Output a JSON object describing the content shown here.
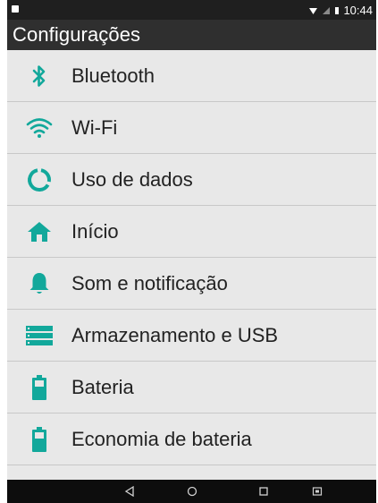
{
  "status_bar": {
    "time": "10:44"
  },
  "app_bar": {
    "title": "Configurações"
  },
  "settings": [
    {
      "label": "Bluetooth",
      "icon": "bluetooth-icon"
    },
    {
      "label": "Wi-Fi",
      "icon": "wifi-icon"
    },
    {
      "label": "Uso de dados",
      "icon": "data-usage-icon"
    },
    {
      "label": "Início",
      "icon": "home-icon"
    },
    {
      "label": "Som e notificação",
      "icon": "bell-icon"
    },
    {
      "label": "Armazenamento e USB",
      "icon": "storage-icon"
    },
    {
      "label": "Bateria",
      "icon": "battery-icon"
    },
    {
      "label": "Economia de bateria",
      "icon": "battery-saver-icon"
    }
  ],
  "colors": {
    "accent": "#12a89b",
    "app_bar": "#2f2f2f",
    "list_bg": "#e8e8e8"
  },
  "nav_bar": {
    "icons": [
      "back-icon",
      "home-nav-icon",
      "recents-icon",
      "screenshot-icon"
    ]
  }
}
